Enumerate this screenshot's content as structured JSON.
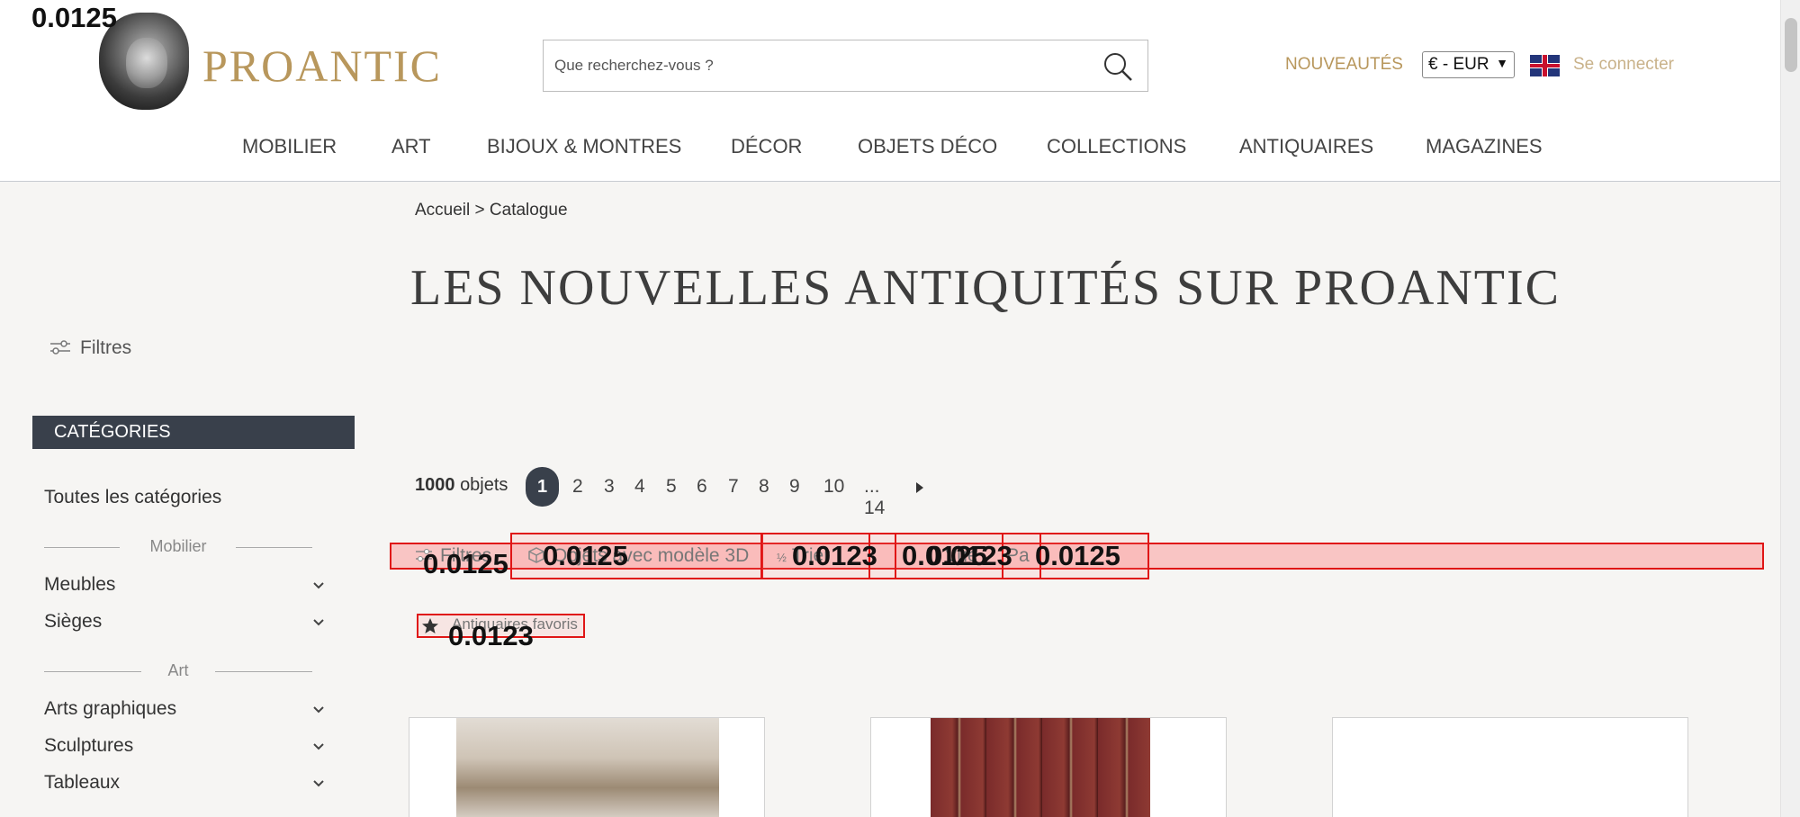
{
  "header": {
    "brand": "PROANTIC",
    "search_placeholder": "Que recherchez-vous ?",
    "new_label": "NOUVEAUTÉS",
    "currency": "€ - EUR",
    "login": "Se connecter",
    "nav": [
      "MOBILIER",
      "ART",
      "BIJOUX & MONTRES",
      "DÉCOR",
      "OBJETS DÉCO",
      "COLLECTIONS",
      "ANTIQUAIRES",
      "MAGAZINES"
    ]
  },
  "breadcrumb": "Accueil > Catalogue",
  "page_title": "LES NOUVELLES ANTIQUITÉS SUR PROANTIC",
  "sidebar": {
    "filters": "Filtres",
    "categories_header": "CATÉGORIES",
    "all": "Toutes les catégories",
    "sections": [
      {
        "title": "Mobilier",
        "items": [
          "Meubles",
          "Sièges"
        ]
      },
      {
        "title": "Art",
        "items": [
          "Arts graphiques",
          "Sculptures",
          "Tableaux"
        ]
      }
    ]
  },
  "results": {
    "count": "1000",
    "count_suffix": "objets",
    "pages": [
      "1",
      "2",
      "3",
      "4",
      "5",
      "6",
      "7",
      "8",
      "9",
      "10"
    ],
    "last_page": "... 14"
  },
  "toolbar": {
    "filters": "Filtres",
    "model3d": "Objets avec modèle 3D",
    "trier": "Trier",
    "vue": "Vue",
    "partage": "Pa",
    "fav": "Antiquaires favoris"
  },
  "overlays": {
    "top_left": "0.0125",
    "filters": "0.0125",
    "model3d": "0.0125",
    "trier": "0.0123",
    "vue": "0.0125",
    "partage": "0.0123",
    "extra": "0.0125",
    "fav": "0.0123"
  }
}
